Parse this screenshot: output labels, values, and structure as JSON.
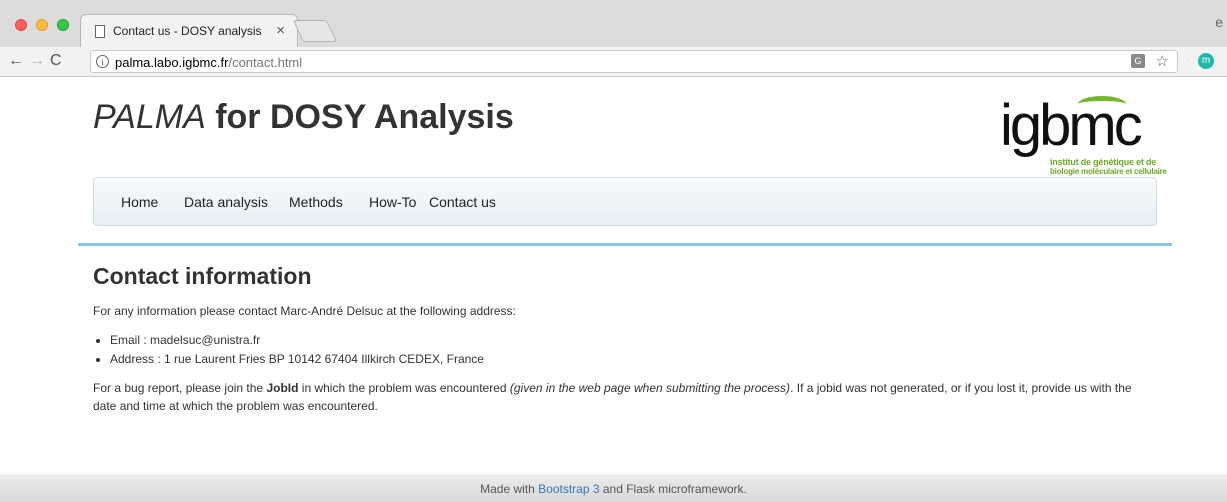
{
  "browser": {
    "tab_title": "Contact us - DOSY analysis",
    "tab_close": "×",
    "url_host": "palma.labo.igbmc.fr",
    "url_path": "/contact.html",
    "info_icon": "i",
    "translate_icon": "G",
    "extension_letter": "m",
    "profile_initial": "e",
    "icons": [
      "back-icon",
      "forward-icon",
      "reload-icon",
      "info-icon",
      "translate-icon",
      "star-icon",
      "extension-icon",
      "menu-icon"
    ]
  },
  "site": {
    "title_em": "PALMA",
    "title_rest": " for DOSY Analysis",
    "logo": {
      "text": "igbmc",
      "line1": "institut de génétique et de",
      "line2": "biologie moléculaire et cellulaire"
    },
    "nav": [
      {
        "label": "Home"
      },
      {
        "label": "Data analysis"
      },
      {
        "label": "Methods"
      },
      {
        "label": "How-To"
      },
      {
        "label": "Contact us"
      }
    ]
  },
  "contact": {
    "heading": "Contact information",
    "intro": "For any information please contact Marc-André Delsuc at the following address:",
    "items": [
      "Email : madelsuc@unistra.fr",
      "Address : 1 rue Laurent Fries BP 10142 67404 Illkirch CEDEX, France"
    ],
    "bug_pre": "For a bug report, please join the ",
    "bug_jobid": "JobId",
    "bug_mid": " in which the problem was encountered ",
    "bug_italic": "(given in the web page when submitting the process)",
    "bug_post": ". If a jobid was not generated, or if you lost it, provide us with the date and time at which the problem was encountered."
  },
  "footer": {
    "pre": "Made with ",
    "link": "Bootstrap 3",
    "post": " and Flask microframework."
  },
  "colors": {
    "accent_divider": "#8ac3e8",
    "link": "#3a77b8",
    "logo_green": "#77b52f"
  }
}
